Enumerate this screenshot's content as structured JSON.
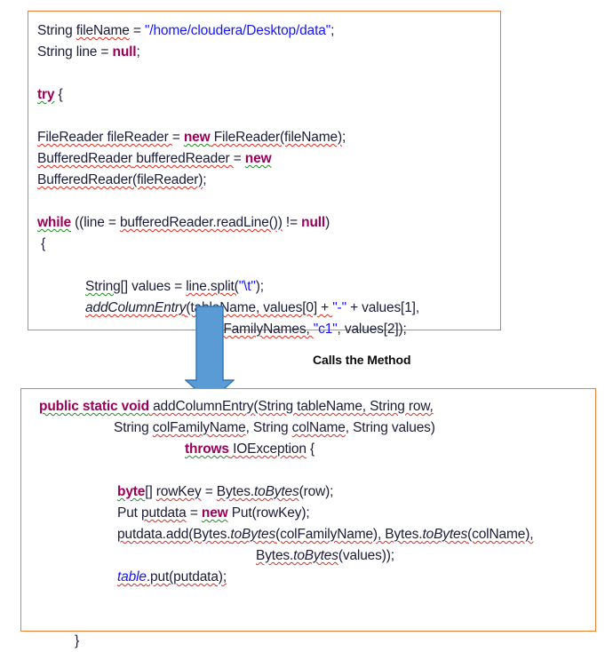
{
  "diagram": {
    "caption": "Calls the Method",
    "arrow_color": "#5B9BD5",
    "arrow_border_color": "#2E74B5",
    "box_border_color": "#ED7D31",
    "keyword_color": "#9B0058",
    "string_color": "#1414FF",
    "text_color": "#1B1B3A",
    "spell_underline_color": "#E02B20",
    "grammar_underline_color": "#1F8A1F"
  },
  "caller_box": {
    "lines": {
      "l1_type": "String",
      "l1_var": "fileName",
      "l1_eq": " = ",
      "l1_str": "\"/home/cloudera/Desktop/data\"",
      "l1_end": ";",
      "l2_type": "String",
      "l2_var": " line = ",
      "l2_kw": "null",
      "l2_end": ";",
      "l3_kw": "try",
      "l3_rest": " {",
      "l4_a": "FileReader",
      "l4_b": " fileReader ",
      "l4_eq": "= ",
      "l4_kw": "new",
      "l4_c": " FileReader(fileName)",
      "l4_end": ";",
      "l5_a": "BufferedReader",
      "l5_b": " bufferedReader ",
      "l5_eq": "= ",
      "l5_kw": "new",
      "l6_a": "BufferedReader(fileReader)",
      "l6_end": ";",
      "l7_kw": "while",
      "l7_a": " ((line = ",
      "l7_b": "bufferedReader.readLine())",
      "l7_c": " != ",
      "l7_kw2": "null",
      "l7_end": ")",
      "l8": " {",
      "l9_a": "String[]",
      "l9_b": " values = ",
      "l9_c": "line.split(",
      "l9_str": "\"\\t\"",
      "l9_end": ");",
      "l10_fn": "addColumnEntry",
      "l10_a": "(tableName, values[0] + ",
      "l10_str": "\"-\"",
      "l10_b": " + values[1],",
      "l11_a": "colFamilyNames, ",
      "l11_str": "\"c1\"",
      "l11_b": ", values[2]);"
    }
  },
  "callee_box": {
    "lines": {
      "m1_kw": "public static void",
      "m1_fn": " addColumnEntry",
      "m1_rest": "(String tableName, String row,",
      "m2_a": "String ",
      "m2_b": "colFamilyName",
      "m2_c": ", String ",
      "m2_d": "colName",
      "m2_e": ", String values)",
      "m3_kw": "throws",
      "m3_a": " IOException",
      "m3_b": " {",
      "m4_kw": "byte",
      "m4_a": "[] ",
      "m4_b": "rowKey",
      "m4_c": " = ",
      "m4_d": "Bytes.",
      "m4_it": "toBytes",
      "m4_e": "(row);",
      "m5_a": "Put ",
      "m5_b": "putdata",
      "m5_c": " = ",
      "m5_kw": "new",
      "m5_d": " Put(rowKey);",
      "m6_a": "putdata.add(Bytes.",
      "m6_it1": "toBytes",
      "m6_b": "(colFamilyName), Bytes.",
      "m6_it2": "toBytes",
      "m6_c": "(colName),",
      "m7_a": "Bytes.",
      "m7_it": "toBytes",
      "m7_b": "(values));",
      "m8_fld": "table",
      "m8_a": ".put(putdata);",
      "m9": "}"
    }
  }
}
